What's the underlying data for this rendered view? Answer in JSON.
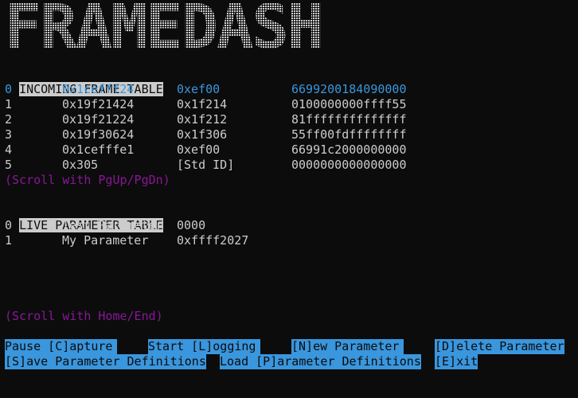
{
  "app": {
    "banner": "FRAMEDASH"
  },
  "frame_table": {
    "title": "INCOMING FRAME TABLE",
    "rows": [
      {
        "idx": "0",
        "time": "0x1cefff24",
        "id": "0xef00",
        "data": "6699200184090000",
        "selected": true
      },
      {
        "idx": "1",
        "time": "0x19f21424",
        "id": "0x1f214",
        "data": "0100000000ffff55",
        "selected": false
      },
      {
        "idx": "2",
        "time": "0x19f21224",
        "id": "0x1f212",
        "data": "81ffffffffffffff",
        "selected": false
      },
      {
        "idx": "3",
        "time": "0x19f30624",
        "id": "0x1f306",
        "data": "55ff00fdffffffff",
        "selected": false
      },
      {
        "idx": "4",
        "time": "0x1cefffe1",
        "id": "0xef00",
        "data": "66991c2000000000",
        "selected": false
      },
      {
        "idx": "5",
        "time": "0x305",
        "id": "[Std ID]",
        "data": "0000000000000000",
        "selected": false
      }
    ],
    "scroll_hint": "(Scroll with PgUp/PgDn)"
  },
  "param_table": {
    "title": "LIVE PARAMETER TABLE",
    "rows": [
      {
        "idx": "0",
        "name": "Test Parameter",
        "value": "0000"
      },
      {
        "idx": "1",
        "name": "My Parameter",
        "value": "0xffff2027"
      }
    ],
    "scroll_hint": "(Scroll with Home/End)"
  },
  "menu": {
    "pause_capture": "Pause [C]apture",
    "start_logging": "Start [L]ogging",
    "new_parameter": "[N]ew Parameter",
    "delete_parameter": "[D]elete Parameter",
    "save_definitions": "[S]ave Parameter Definitions",
    "load_definitions": "Load [P]arameter Definitions",
    "exit": "[E]xit"
  },
  "colors": {
    "background": "#0c0c0c",
    "foreground": "#cccccc",
    "accent_blue": "#3a96dd",
    "hint_purple": "#881798"
  }
}
